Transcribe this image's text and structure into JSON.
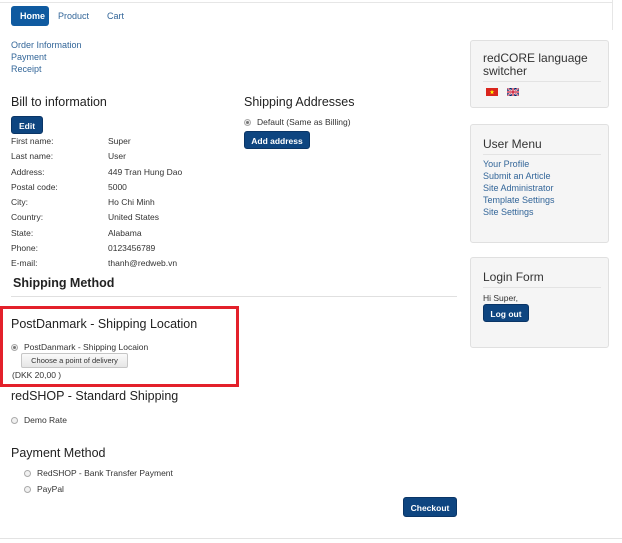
{
  "nav": {
    "tabs": [
      {
        "label": "Home",
        "active": true
      },
      {
        "label": "Product",
        "active": false
      },
      {
        "label": "Cart",
        "active": false
      }
    ]
  },
  "steps": [
    "Order Information",
    "Payment",
    "Receipt"
  ],
  "bill_to": {
    "title": "Bill to information",
    "edit_label": "Edit",
    "fields": [
      {
        "label": "First name:",
        "value": "Super"
      },
      {
        "label": "Last name:",
        "value": "User"
      },
      {
        "label": "Address:",
        "value": "449 Tran Hung Dao"
      },
      {
        "label": "Postal code:",
        "value": "5000"
      },
      {
        "label": "City:",
        "value": "Ho Chi Minh"
      },
      {
        "label": "Country:",
        "value": "United States"
      },
      {
        "label": "State:",
        "value": "Alabama"
      },
      {
        "label": "Phone:",
        "value": "0123456789"
      },
      {
        "label": "E-mail:",
        "value": "thanh@redweb.vn"
      }
    ]
  },
  "shipping_addresses": {
    "title": "Shipping Addresses",
    "default_option": "Default (Same as Billing)",
    "add_label": "Add address"
  },
  "shipping_method": {
    "title": "Shipping Method",
    "postdanmark": {
      "title": "PostDanmark - Shipping Location",
      "option": "PostDanmark - Shipping Locaion",
      "choose_label": "Choose a point of delivery",
      "price": "(DKK 20,00 )"
    },
    "standard": {
      "title": "redSHOP - Standard Shipping",
      "option": "Demo Rate"
    }
  },
  "payment": {
    "title": "Payment Method",
    "options": [
      "RedSHOP - Bank Transfer Payment",
      "PayPal"
    ],
    "checkout_label": "Checkout"
  },
  "sidebar": {
    "language": {
      "title": "redCORE language switcher"
    },
    "user_menu": {
      "title": "User Menu",
      "items": [
        "Your Profile",
        "Submit an Article",
        "Site Administrator",
        "Template Settings",
        "Site Settings"
      ]
    },
    "login": {
      "title": "Login Form",
      "greeting": "Hi Super,",
      "logout_label": "Log out"
    }
  },
  "colors": {
    "accent": "#0e4580",
    "link": "#336699",
    "highlight": "#e3202a"
  }
}
